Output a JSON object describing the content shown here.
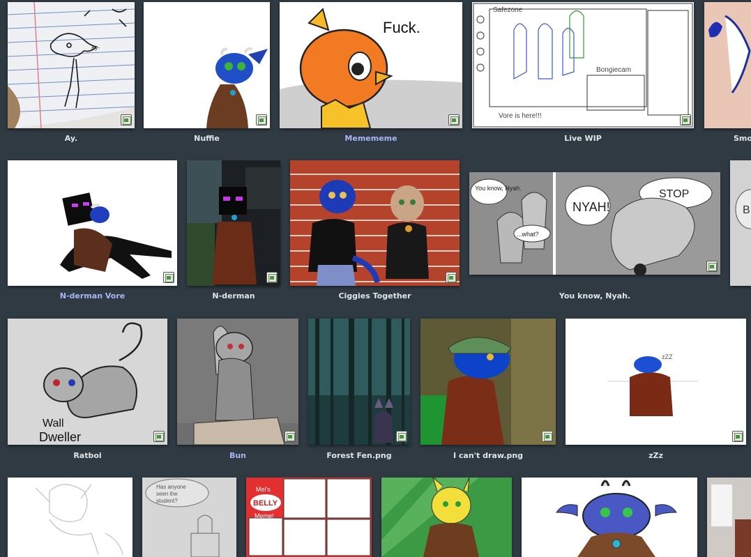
{
  "colors": {
    "background": "#2f3a42",
    "caption": "#dfe5e8",
    "caption_link": "#a9b7f6"
  },
  "icons": {
    "thumbnail_badge": "image-file-icon"
  },
  "rows": [
    {
      "items": [
        {
          "title": "Ay."
        },
        {
          "title": "Nuffie"
        },
        {
          "title": "Memememe",
          "highlighted": true,
          "image_text": "Fuck."
        },
        {
          "title": "Live WIP",
          "image_text": [
            "Safezone",
            "Bongiecam",
            "Vore is here!!!"
          ]
        },
        {
          "title": "Smo"
        }
      ]
    },
    {
      "items": [
        {
          "title": "N-derman Vore",
          "highlighted": true
        },
        {
          "title": "N-derman"
        },
        {
          "title": "Ciggies Together"
        },
        {
          "title": "You know, Nyah.",
          "image_text": [
            "You know, Nyah.",
            "...what?",
            "NYAH!",
            "STOP"
          ]
        },
        {
          "title": ""
        }
      ]
    },
    {
      "items": [
        {
          "title": "Ratboi",
          "image_text": [
            "Wall",
            "Dweller"
          ]
        },
        {
          "title": "Bun",
          "highlighted": true
        },
        {
          "title": "Forest Fen.png"
        },
        {
          "title": "I can't draw.png"
        },
        {
          "title": "zZz",
          "image_text": "zZZ"
        }
      ]
    },
    {
      "items": [
        {
          "title": ""
        },
        {
          "title": "",
          "image_text": [
            "Has anyone",
            "seen the",
            "student?"
          ]
        },
        {
          "title": "",
          "image_text": [
            "Mel's",
            "BELLY",
            "Meme!"
          ]
        },
        {
          "title": ""
        },
        {
          "title": ""
        },
        {
          "title": ""
        }
      ]
    }
  ]
}
